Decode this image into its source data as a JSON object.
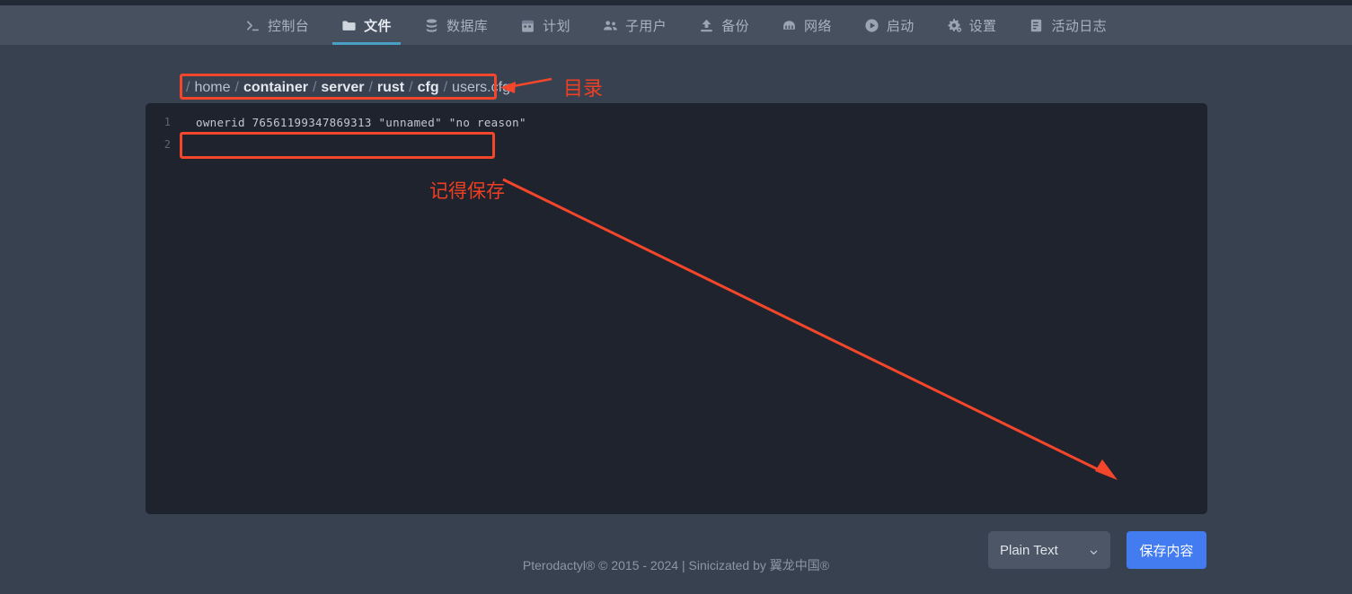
{
  "nav": {
    "items": [
      {
        "label": "控制台",
        "icon": "terminal-icon",
        "active": false
      },
      {
        "label": "文件",
        "icon": "folder-icon",
        "active": true
      },
      {
        "label": "数据库",
        "icon": "database-icon",
        "active": false
      },
      {
        "label": "计划",
        "icon": "calendar-icon",
        "active": false
      },
      {
        "label": "子用户",
        "icon": "users-icon",
        "active": false
      },
      {
        "label": "备份",
        "icon": "upload-icon",
        "active": false
      },
      {
        "label": "网络",
        "icon": "network-icon",
        "active": false
      },
      {
        "label": "启动",
        "icon": "play-icon",
        "active": false
      },
      {
        "label": "设置",
        "icon": "gear-icon",
        "active": false
      },
      {
        "label": "活动日志",
        "icon": "log-icon",
        "active": false
      }
    ]
  },
  "breadcrumb": {
    "root": "/",
    "segments": [
      {
        "name": "home",
        "bold": false
      },
      {
        "name": "container",
        "bold": true
      },
      {
        "name": "server",
        "bold": true
      },
      {
        "name": "rust",
        "bold": true
      },
      {
        "name": "cfg",
        "bold": true
      },
      {
        "name": "users.cfg",
        "bold": false
      }
    ],
    "separator": "/"
  },
  "editor": {
    "lines": [
      {
        "number": "1",
        "text": "ownerid 76561199347869313 \"unnamed\" \"no reason\""
      },
      {
        "number": "2",
        "text": ""
      }
    ]
  },
  "controls": {
    "language_select": "Plain Text",
    "save_label": "保存内容"
  },
  "footer": {
    "text": "Pterodactyl® © 2015 - 2024 | Sinicizated by 翼龙中国®"
  },
  "annotations": {
    "directory_label": "目录",
    "remember_save_label": "记得保存",
    "color": "#ef3f22"
  },
  "colors": {
    "page_bg": "#374150",
    "nav_bg": "#46505f",
    "editor_bg": "#1f232e",
    "accent_tab": "#4a9fc4",
    "save_button": "#437bf0",
    "annotation": "#ef3f22"
  }
}
